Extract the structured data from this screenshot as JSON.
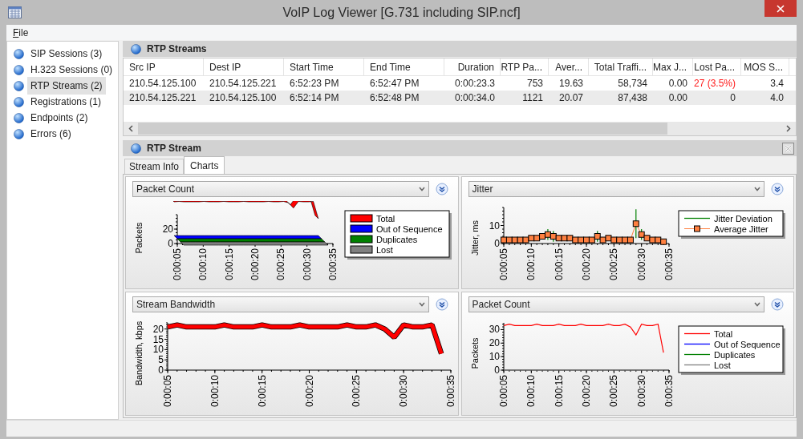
{
  "window": {
    "title": "VoIP Log Viewer [G.731 including SIP.ncf]"
  },
  "menu": [
    {
      "label": "File"
    }
  ],
  "sidebar": {
    "items": [
      {
        "label": "SIP Sessions (3)",
        "selected": false
      },
      {
        "label": "H.323 Sessions (0)",
        "selected": false
      },
      {
        "label": "RTP Streams (2)",
        "selected": true
      },
      {
        "label": "Registrations (1)",
        "selected": false
      },
      {
        "label": "Endpoints (2)",
        "selected": false
      },
      {
        "label": "Errors (6)",
        "selected": false
      }
    ]
  },
  "rtp_streams": {
    "title": "RTP Streams",
    "columns": [
      "Src IP",
      "Dest IP",
      "Start Time",
      "End Time",
      "Duration",
      "RTP Pa...",
      "Aver...",
      "Total Traffi...",
      "Max J...",
      "Lost Pa...",
      "MOS S..."
    ],
    "rows": [
      {
        "cells": [
          "210.54.125.100",
          "210.54.125.221",
          "6:52:23 PM",
          "6:52:47 PM",
          "0:00:23.3",
          "753",
          "19.63",
          "58,734",
          "0.00",
          "27 (3.5%)",
          "3.4"
        ],
        "lost_alert": true
      },
      {
        "cells": [
          "210.54.125.221",
          "210.54.125.100",
          "6:52:14 PM",
          "6:52:48 PM",
          "0:00:34.0",
          "1121",
          "20.07",
          "87,438",
          "0.00",
          "0",
          "4.0"
        ],
        "lost_alert": false
      }
    ]
  },
  "stream_panel": {
    "title": "RTP Stream",
    "tabs": [
      {
        "label": "Stream Info",
        "selected": false
      },
      {
        "label": "Charts",
        "selected": true
      }
    ],
    "charts": [
      {
        "kind": "picture3d",
        "selector": "Packet Count",
        "ylabel": "Packets",
        "yticks": [
          "20",
          "0"
        ],
        "xticks": [
          "0:00:05",
          "0:00:10",
          "0:00:15",
          "0:00:20",
          "0:00:25",
          "0:00:30",
          "0:00:35"
        ],
        "legend": [
          {
            "label": "Total",
            "color": "#ff0000"
          },
          {
            "label": "Out of Sequence",
            "color": "#0000ff"
          },
          {
            "label": "Duplicates",
            "color": "#008000"
          },
          {
            "label": "Lost",
            "color": "#808080"
          }
        ]
      },
      {
        "kind": "flat",
        "selector": "Jitter",
        "chart_data": {
          "type": "line",
          "ylabel": "Jitter, ms",
          "legend": "right",
          "x": [
            5,
            6,
            7,
            8,
            9,
            10,
            11,
            12,
            13,
            14,
            15,
            16,
            17,
            18,
            19,
            20,
            21,
            22,
            23,
            24,
            25,
            26,
            27,
            28,
            29,
            30,
            31,
            32,
            33,
            34
          ],
          "xlim": [
            5,
            35
          ],
          "ylim": [
            0,
            20
          ],
          "yticks": [
            0,
            10
          ],
          "xticks": [
            {
              "value": 5,
              "label": "0:00:05"
            },
            {
              "value": 10,
              "label": "0:00:10"
            },
            {
              "value": 15,
              "label": "0:00:15"
            },
            {
              "value": 20,
              "label": "0:00:20"
            },
            {
              "value": 25,
              "label": "0:00:25"
            },
            {
              "value": 30,
              "label": "0:00:30"
            },
            {
              "value": 35,
              "label": "0:00:35"
            }
          ],
          "series": [
            {
              "name": "Jitter Deviation",
              "color": "#008000",
              "values": [
                null,
                null,
                null,
                null,
                null,
                null,
                null,
                null,
                null,
                null,
                null,
                null,
                null,
                null,
                null,
                null,
                null,
                null,
                null,
                null,
                null,
                null,
                null,
                null,
                null,
                null,
                null,
                null,
                null,
                null
              ]
            },
            {
              "name": "Average Jitter",
              "color": "#ff8040",
              "marker": "square",
              "values": [
                2,
                2,
                2,
                2,
                2,
                3,
                3,
                4,
                5,
                4,
                3,
                3,
                3,
                2,
                2,
                2,
                2,
                4,
                2,
                3,
                2,
                2,
                2,
                2,
                11,
                5,
                3,
                2,
                2,
                1
              ],
              "errors": [
                0,
                0,
                0,
                0,
                0,
                0,
                0,
                0,
                3,
                3,
                0,
                0,
                0,
                0,
                0,
                0,
                0,
                3,
                0,
                0,
                0,
                0,
                0,
                0,
                8,
                3,
                0,
                0,
                0,
                0
              ]
            }
          ]
        }
      },
      {
        "kind": "ribbon",
        "selector": "Stream Bandwidth",
        "chart_data": {
          "type": "line",
          "ylabel": "Bandwidth, kbps",
          "x": [
            5,
            6,
            7,
            8,
            9,
            10,
            11,
            12,
            13,
            14,
            15,
            16,
            17,
            18,
            19,
            20,
            21,
            22,
            23,
            24,
            25,
            26,
            27,
            28,
            29,
            30,
            31,
            32,
            33,
            34
          ],
          "xlim": [
            5,
            35
          ],
          "ylim": [
            0,
            23
          ],
          "yticks": [
            0,
            5,
            10,
            15,
            20
          ],
          "xticks": [
            {
              "value": 5,
              "label": "0:00:05"
            },
            {
              "value": 10,
              "label": "0:00:10"
            },
            {
              "value": 15,
              "label": "0:00:15"
            },
            {
              "value": 20,
              "label": "0:00:20"
            },
            {
              "value": 25,
              "label": "0:00:25"
            },
            {
              "value": 30,
              "label": "0:00:30"
            },
            {
              "value": 35,
              "label": "0:00:35"
            }
          ],
          "series": [
            {
              "color": "#ff0000",
              "values": [
                21,
                22,
                21,
                21,
                21,
                21,
                22,
                21,
                21,
                21,
                22,
                21,
                21,
                21,
                22,
                21,
                21,
                21,
                21,
                22,
                21,
                21,
                22,
                20,
                16,
                22,
                21,
                21,
                22,
                8
              ]
            }
          ]
        }
      },
      {
        "kind": "flat",
        "selector": "Packet Count",
        "chart_data": {
          "type": "line",
          "ylabel": "Packets",
          "legend": "right",
          "x": [
            5,
            6,
            7,
            8,
            9,
            10,
            11,
            12,
            13,
            14,
            15,
            16,
            17,
            18,
            19,
            20,
            21,
            22,
            23,
            24,
            25,
            26,
            27,
            28,
            29,
            30,
            31,
            32,
            33,
            34
          ],
          "xlim": [
            5,
            35
          ],
          "ylim": [
            0,
            35
          ],
          "yticks": [
            0,
            10,
            20,
            30
          ],
          "xticks": [
            {
              "value": 5,
              "label": "0:00:05"
            },
            {
              "value": 10,
              "label": "0:00:10"
            },
            {
              "value": 15,
              "label": "0:00:15"
            },
            {
              "value": 20,
              "label": "0:00:20"
            },
            {
              "value": 25,
              "label": "0:00:25"
            },
            {
              "value": 30,
              "label": "0:00:30"
            },
            {
              "value": 35,
              "label": "0:00:35"
            }
          ],
          "series": [
            {
              "name": "Total",
              "color": "#ff0000",
              "values": [
                33,
                34,
                33,
                33,
                33,
                33,
                34,
                33,
                33,
                33,
                34,
                33,
                33,
                33,
                34,
                33,
                33,
                33,
                33,
                34,
                33,
                33,
                34,
                32,
                26,
                34,
                33,
                33,
                34,
                13
              ]
            },
            {
              "name": "Out of Sequence",
              "color": "#0000ff",
              "values": [
                null,
                null,
                null,
                null,
                null,
                null,
                null,
                null,
                null,
                null,
                null,
                null,
                null,
                null,
                null,
                null,
                null,
                null,
                null,
                null,
                null,
                null,
                null,
                null,
                null,
                null,
                null,
                null,
                null,
                null
              ]
            },
            {
              "name": "Duplicates",
              "color": "#008000",
              "values": [
                null,
                null,
                null,
                null,
                null,
                null,
                null,
                null,
                null,
                null,
                null,
                null,
                null,
                null,
                null,
                null,
                null,
                null,
                null,
                null,
                null,
                null,
                null,
                null,
                null,
                null,
                null,
                null,
                null,
                null
              ]
            },
            {
              "name": "Lost",
              "color": "#808080",
              "values": [
                0,
                0,
                0,
                0,
                0,
                0,
                0,
                0,
                0,
                0,
                0,
                0,
                0,
                0,
                0,
                0,
                0,
                0,
                0,
                0,
                0,
                0,
                0,
                0,
                0,
                0,
                0,
                0,
                0,
                0
              ]
            }
          ]
        }
      }
    ]
  }
}
